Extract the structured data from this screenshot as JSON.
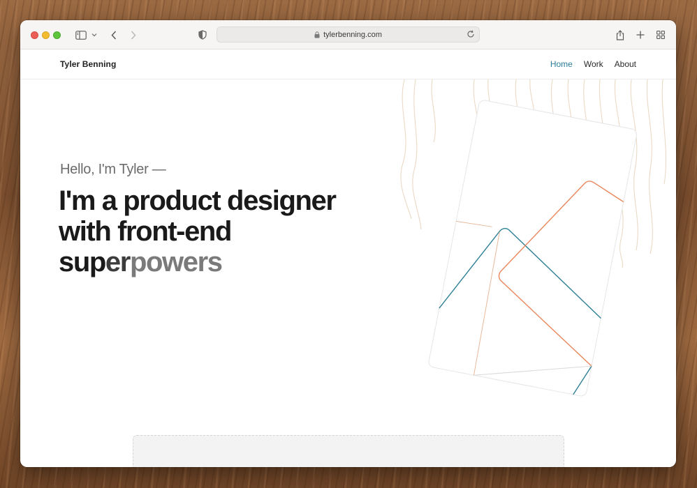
{
  "browser": {
    "url": "tylerbenning.com",
    "icons": [
      "sidebar-icon",
      "chevron-down-icon",
      "back-icon",
      "forward-icon",
      "shield-icon",
      "lock-icon",
      "reload-icon",
      "share-icon",
      "new-tab-icon",
      "tab-overview-icon"
    ]
  },
  "site": {
    "brand": "Tyler Benning",
    "nav": [
      {
        "label": "Home",
        "active": true
      },
      {
        "label": "Work",
        "active": false
      },
      {
        "label": "About",
        "active": false
      }
    ]
  },
  "hero": {
    "greeting": "Hello, I'm Tyler —",
    "line1": "I'm a product designer",
    "line2": "with front-end",
    "line3_a": "sup",
    "line3_b": "er",
    "line3_c": "powers"
  },
  "colors": {
    "accent": "#2a7d9b",
    "orange": "#e8865a",
    "teal": "#2e7f96",
    "wood_lines": "#ead9c4"
  }
}
